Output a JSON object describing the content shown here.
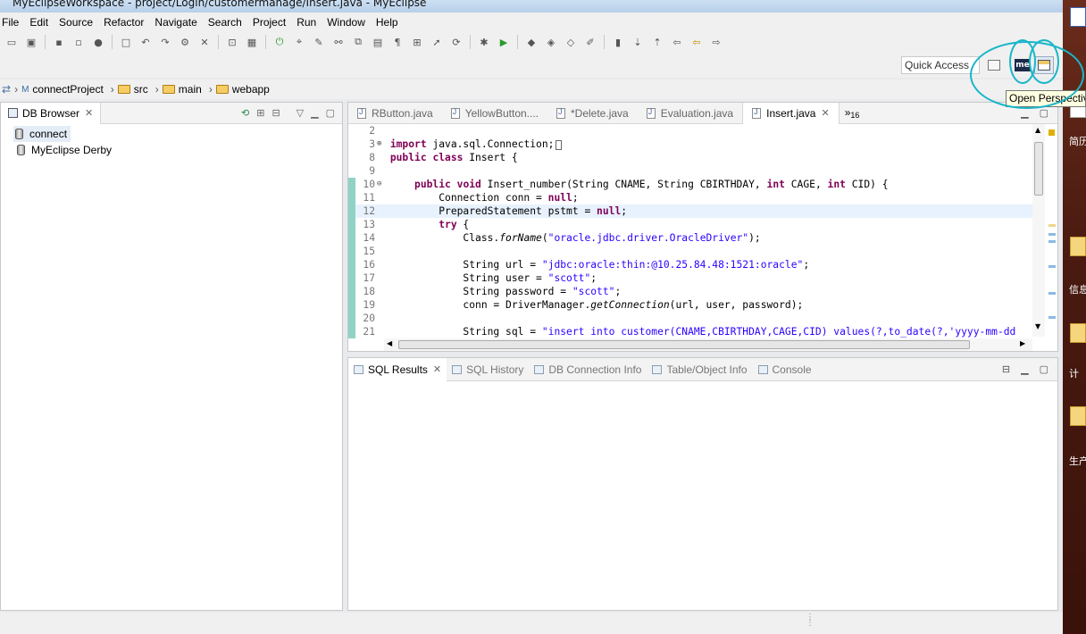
{
  "window": {
    "title": "MyEclipseWorkspace - project/Login/customermanage/Insert.java - MyEclipse"
  },
  "menu": [
    "File",
    "Edit",
    "Source",
    "Refactor",
    "Navigate",
    "Search",
    "Project",
    "Run",
    "Window",
    "Help"
  ],
  "toolbar": {
    "quick_access": "Quick Access",
    "perspective_badge": "me"
  },
  "breadcrumb": [
    "connectProject",
    "src",
    "main",
    "webapp"
  ],
  "db_panel": {
    "tab": "DB Browser",
    "nodes": [
      "connect",
      "MyEclipse Derby"
    ]
  },
  "editor": {
    "tabs": [
      "RButton.java",
      "YellowButton....",
      "*Delete.java",
      "Evaluation.java",
      "Insert.java"
    ],
    "active_tab": 4,
    "overflow": "16",
    "lines": [
      {
        "n": "2",
        "t": ""
      },
      {
        "n": "3",
        "t": "import java.sql.Connection;"
      },
      {
        "n": "8",
        "t": "public class Insert {"
      },
      {
        "n": "9",
        "t": ""
      },
      {
        "n": "10",
        "t": "    public void Insert_number(String CNAME, String CBIRTHDAY, int CAGE, int CID) {"
      },
      {
        "n": "11",
        "t": "        Connection conn = null;"
      },
      {
        "n": "12",
        "t": "        PreparedStatement pstmt = null;"
      },
      {
        "n": "13",
        "t": "        try {"
      },
      {
        "n": "14",
        "t": "            Class.forName(\"oracle.jdbc.driver.OracleDriver\");"
      },
      {
        "n": "15",
        "t": ""
      },
      {
        "n": "16",
        "t": "            String url = \"jdbc:oracle:thin:@10.25.84.48:1521:oracle\";"
      },
      {
        "n": "17",
        "t": "            String user = \"scott\";"
      },
      {
        "n": "18",
        "t": "            String password = \"scott\";"
      },
      {
        "n": "19",
        "t": "            conn = DriverManager.getConnection(url, user, password);"
      },
      {
        "n": "20",
        "t": ""
      },
      {
        "n": "21",
        "t": "            String sql = \"insert into customer(CNAME,CBIRTHDAY,CAGE,CID) values(?,to_date(?,'yyyy-mm-dd"
      }
    ]
  },
  "bottom_panel": {
    "tabs": [
      "SQL Results",
      "SQL History",
      "DB Connection Info",
      "Table/Object Info",
      "Console"
    ]
  },
  "tooltip": "Open Perspective",
  "desktop": {
    "labels": [
      "简历",
      "信息",
      "计",
      "生产"
    ]
  },
  "colors": {
    "highlight_circle": "#19b6c9",
    "keyword": "#7f0055",
    "string": "#2a00ff"
  }
}
